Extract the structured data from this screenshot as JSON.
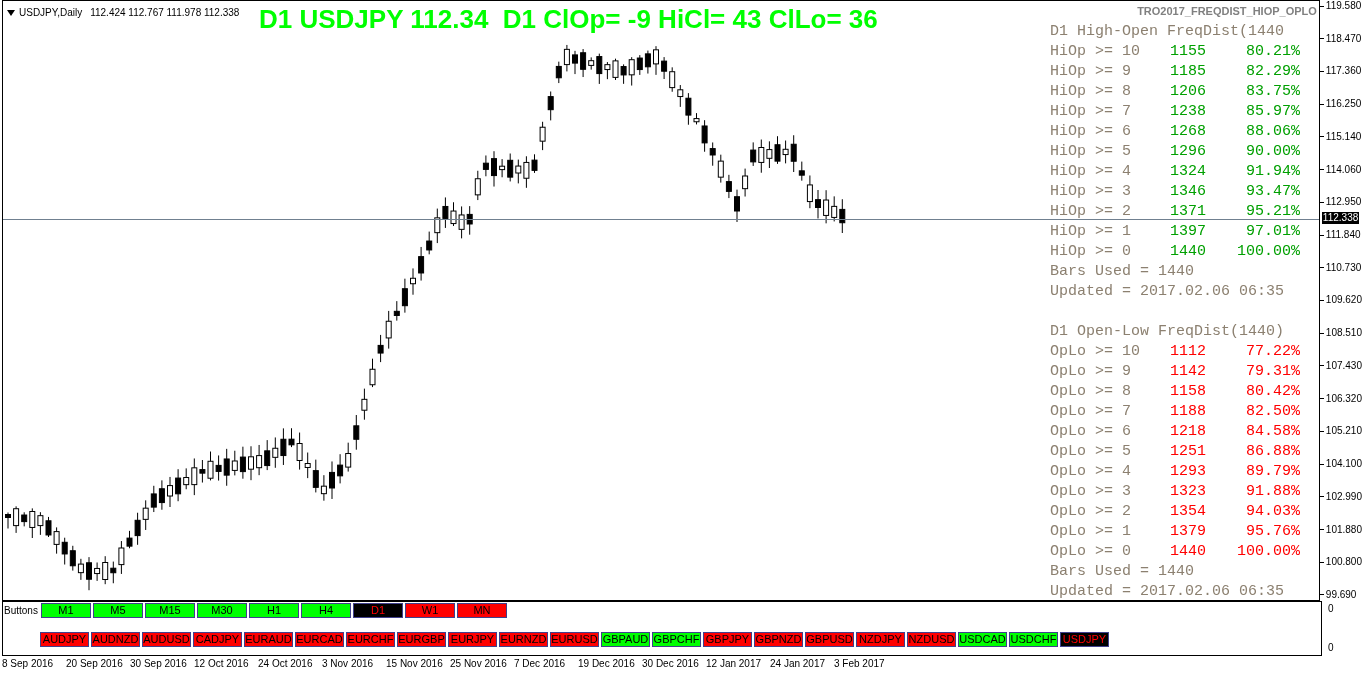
{
  "chart_header": {
    "symbol_label": "USDJPY,Daily",
    "ohlc": "112.424 112.767 111.978 112.338"
  },
  "headline": "D1 USDJPY 112.34  D1 ClOp= -9 HiCl= 43 ClLo= 36",
  "indicator_name": "TRO2017_FREQDIST_HIOP_OPLO",
  "sections": [
    {
      "color": "#00a000",
      "title": "D1 High-Open FreqDist(1440",
      "rows": [
        {
          "label": "HiOp >= 10",
          "count": "1155",
          "pct": "80.21%"
        },
        {
          "label": "HiOp >= 9",
          "count": "1185",
          "pct": "82.29%"
        },
        {
          "label": "HiOp >= 8",
          "count": "1206",
          "pct": "83.75%"
        },
        {
          "label": "HiOp >= 7",
          "count": "1238",
          "pct": "85.97%"
        },
        {
          "label": "HiOp >= 6",
          "count": "1268",
          "pct": "88.06%"
        },
        {
          "label": "HiOp >= 5",
          "count": "1296",
          "pct": "90.00%"
        },
        {
          "label": "HiOp >= 4",
          "count": "1324",
          "pct": "91.94%"
        },
        {
          "label": "HiOp >= 3",
          "count": "1346",
          "pct": "93.47%"
        },
        {
          "label": "HiOp >= 2",
          "count": "1371",
          "pct": "95.21%"
        },
        {
          "label": "HiOp >= 1",
          "count": "1397",
          "pct": "97.01%"
        },
        {
          "label": "HiOp >= 0",
          "count": "1440",
          "pct": "100.00%"
        }
      ],
      "bars_used": "Bars Used = 1440",
      "updated": "Updated = 2017.02.06 06:35"
    },
    {
      "color": "#ff0000",
      "title": "D1 Open-Low FreqDist(1440)",
      "rows": [
        {
          "label": "OpLo >= 10",
          "count": "1112",
          "pct": "77.22%"
        },
        {
          "label": "OpLo >= 9",
          "count": "1142",
          "pct": "79.31%"
        },
        {
          "label": "OpLo >= 8",
          "count": "1158",
          "pct": "80.42%"
        },
        {
          "label": "OpLo >= 7",
          "count": "1188",
          "pct": "82.50%"
        },
        {
          "label": "OpLo >= 6",
          "count": "1218",
          "pct": "84.58%"
        },
        {
          "label": "OpLo >= 5",
          "count": "1251",
          "pct": "86.88%"
        },
        {
          "label": "OpLo >= 4",
          "count": "1293",
          "pct": "89.79%"
        },
        {
          "label": "OpLo >= 3",
          "count": "1323",
          "pct": "91.88%"
        },
        {
          "label": "OpLo >= 2",
          "count": "1354",
          "pct": "94.03%"
        },
        {
          "label": "OpLo >= 1",
          "count": "1379",
          "pct": "95.76%"
        },
        {
          "label": "OpLo >= 0",
          "count": "1440",
          "pct": "100.00%"
        }
      ],
      "bars_used": "Bars Used = 1440",
      "updated": "Updated = 2017.02.06 06:35"
    }
  ],
  "price_axis": [
    "119.580",
    "118.470",
    "117.360",
    "116.250",
    "115.140",
    "114.060",
    "112.950",
    "111.840",
    "110.730",
    "109.620",
    "108.510",
    "107.430",
    "106.320",
    "105.210",
    "104.100",
    "102.990",
    "101.880",
    "100.800",
    "99.690"
  ],
  "current_price": "112.338",
  "subwindow": {
    "label": "Buttons",
    "axis": [
      "0",
      "0"
    ],
    "timeframes": [
      {
        "label": "M1",
        "color": "#00ff00",
        "selected": false
      },
      {
        "label": "M5",
        "color": "#00ff00",
        "selected": false
      },
      {
        "label": "M15",
        "color": "#00ff00",
        "selected": false
      },
      {
        "label": "M30",
        "color": "#00ff00",
        "selected": false
      },
      {
        "label": "H1",
        "color": "#00ff00",
        "selected": false
      },
      {
        "label": "H4",
        "color": "#00ff00",
        "selected": false
      },
      {
        "label": "D1",
        "color": "#000000",
        "selected": true
      },
      {
        "label": "W1",
        "color": "#ff0000",
        "selected": false
      },
      {
        "label": "MN",
        "color": "#ff0000",
        "selected": false
      }
    ],
    "pairs": [
      {
        "label": "AUDJPY",
        "color": "#ff0000",
        "selected": false
      },
      {
        "label": "AUDNZD",
        "color": "#ff0000",
        "selected": false
      },
      {
        "label": "AUDUSD",
        "color": "#ff0000",
        "selected": false
      },
      {
        "label": "CADJPY",
        "color": "#ff0000",
        "selected": false
      },
      {
        "label": "EURAUD",
        "color": "#ff0000",
        "selected": false
      },
      {
        "label": "EURCAD",
        "color": "#ff0000",
        "selected": false
      },
      {
        "label": "EURCHF",
        "color": "#ff0000",
        "selected": false
      },
      {
        "label": "EURGBP",
        "color": "#ff0000",
        "selected": false
      },
      {
        "label": "EURJPY",
        "color": "#ff0000",
        "selected": false
      },
      {
        "label": "EURNZD",
        "color": "#ff0000",
        "selected": false
      },
      {
        "label": "EURUSD",
        "color": "#ff0000",
        "selected": false
      },
      {
        "label": "GBPAUD",
        "color": "#00ff00",
        "selected": false
      },
      {
        "label": "GBPCHF",
        "color": "#00ff00",
        "selected": false
      },
      {
        "label": "GBPJPY",
        "color": "#ff0000",
        "selected": false
      },
      {
        "label": "GBPNZD",
        "color": "#ff0000",
        "selected": false
      },
      {
        "label": "GBPUSD",
        "color": "#ff0000",
        "selected": false
      },
      {
        "label": "NZDJPY",
        "color": "#ff0000",
        "selected": false
      },
      {
        "label": "NZDUSD",
        "color": "#ff0000",
        "selected": false
      },
      {
        "label": "USDCAD",
        "color": "#00ff00",
        "selected": false
      },
      {
        "label": "USDCHF",
        "color": "#00ff00",
        "selected": false
      },
      {
        "label": "USDJPY",
        "color": "#000000",
        "selected": true
      }
    ]
  },
  "date_axis": [
    "8 Sep 2016",
    "20 Sep 2016",
    "30 Sep 2016",
    "12 Oct 2016",
    "24 Oct 2016",
    "3 Nov 2016",
    "15 Nov 2016",
    "25 Nov 2016",
    "7 Dec 2016",
    "19 Dec 2016",
    "30 Dec 2016",
    "12 Jan 2017",
    "24 Jan 2017",
    "3 Feb 2017"
  ]
}
